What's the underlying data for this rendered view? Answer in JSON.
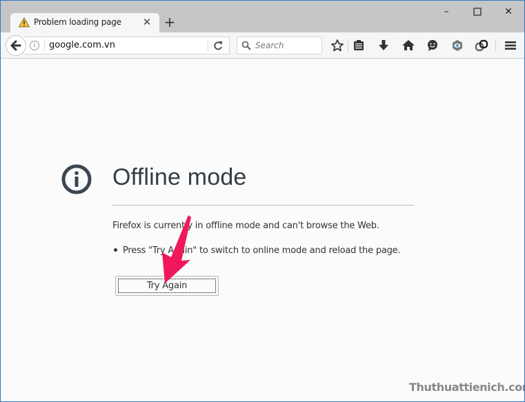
{
  "window": {
    "controls": {
      "minimize": "–",
      "maximize": "☐",
      "close": "✕"
    }
  },
  "tab": {
    "title": "Problem loading page",
    "icon": "warning-icon",
    "close_glyph": "✕",
    "new_tab_glyph": "+"
  },
  "navbar": {
    "url": "google.com.vn",
    "search_placeholder": "Search",
    "icons": [
      "back-icon",
      "info-icon",
      "reload-icon",
      "search-icon",
      "bookmark-star-icon",
      "reading-list-icon",
      "download-icon",
      "home-icon",
      "chat-icon",
      "eye-extension-icon",
      "sync-icon",
      "menu-icon"
    ]
  },
  "page": {
    "heading": "Offline mode",
    "description": "Firefox is currently in offline mode and can't browse the Web.",
    "bullet": "Press \"Try Again\" to switch to online mode and reload the page.",
    "try_again_label": "Try Again"
  },
  "annotation": {
    "arrow_color": "#f0185a"
  },
  "watermark": "Thuthuattienich.com"
}
